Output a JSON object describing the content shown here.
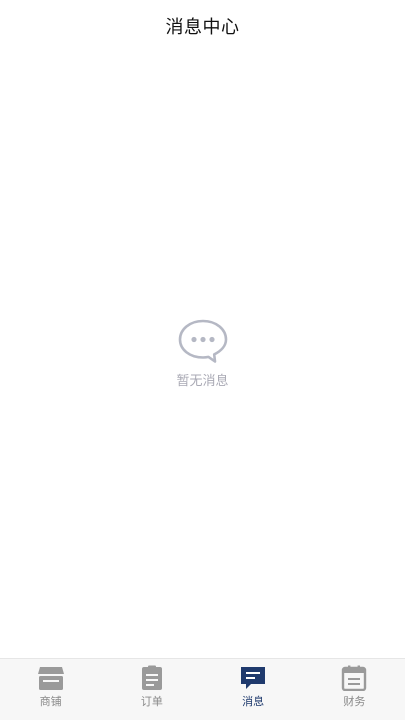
{
  "header": {
    "title": "消息中心"
  },
  "empty_state": {
    "icon": "chat-bubble-icon",
    "text": "暂无消息"
  },
  "tabbar": {
    "active": "消息",
    "items": [
      {
        "label": "商铺",
        "icon": "store-icon"
      },
      {
        "label": "订单",
        "icon": "clipboard-icon"
      },
      {
        "label": "消息",
        "icon": "message-icon"
      },
      {
        "label": "财务",
        "icon": "calendar-icon"
      }
    ]
  },
  "colors": {
    "active_tab": "#1f3a6d",
    "inactive_tab": "#8a8a8a",
    "empty_icon": "#b5b8c4",
    "empty_text": "#a9a9b4"
  }
}
